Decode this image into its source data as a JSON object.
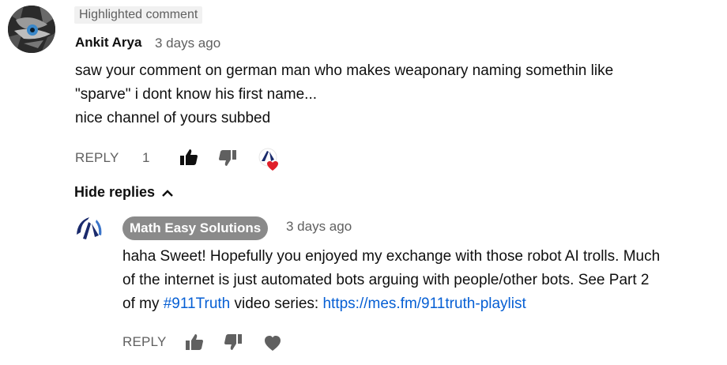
{
  "comment": {
    "badge": "Highlighted comment",
    "author": "Ankit Arya",
    "time": "3 days ago",
    "text_line1": "saw your comment on german man who makes weaponary naming somethin like",
    "text_line2": "\"sparve\" i dont know his first name...",
    "text_line3": "nice channel of yours subbed",
    "reply_label": "REPLY",
    "like_count": "1"
  },
  "hide_replies_label": "Hide replies",
  "reply": {
    "author": "Math Easy Solutions",
    "time": "3 days ago",
    "text_line1": "haha Sweet! Hopefully you enjoyed my exchange with those robot AI trolls. Much",
    "text_line2": "of the internet is just automated bots arguing with people/other bots. See Part 2",
    "text_line3_prefix": "of my ",
    "hashtag": "#911Truth",
    "text_line3_mid": " video series: ",
    "link": "https://mes.fm/911truth-playlist",
    "reply_label": "REPLY"
  },
  "colors": {
    "link": "#065fd4",
    "heart": "#e0202a",
    "author_pill": "#8a8a8a",
    "secondary_text": "#606060"
  }
}
